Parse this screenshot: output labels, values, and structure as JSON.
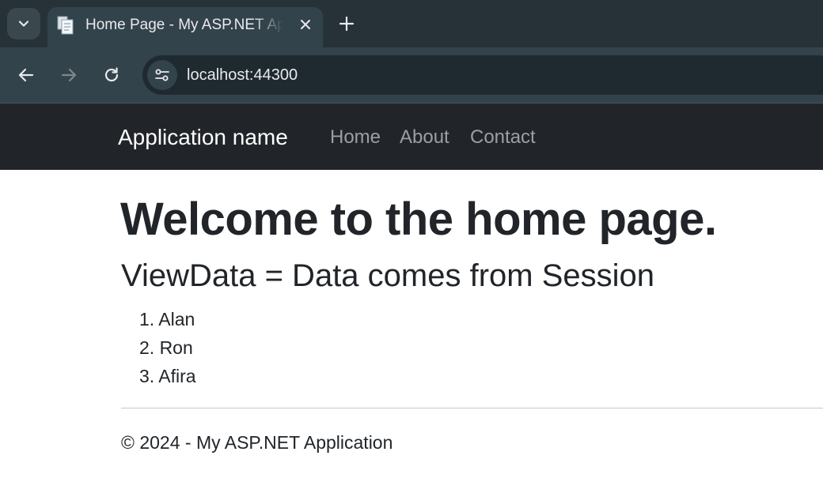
{
  "browser": {
    "tab": {
      "title": "Home Page - My ASP.NET Application"
    },
    "address": {
      "url": "localhost:44300"
    }
  },
  "site": {
    "brand": "Application name",
    "nav": [
      {
        "label": "Home"
      },
      {
        "label": "About"
      },
      {
        "label": "Contact"
      }
    ]
  },
  "main": {
    "heading": "Welcome to the home page.",
    "subheading": "ViewData = Data comes from Session",
    "items": [
      {
        "label": "1. Alan"
      },
      {
        "label": "2. Ron"
      },
      {
        "label": "3. Afira"
      }
    ]
  },
  "footer": {
    "text": "© 2024 - My ASP.NET Application"
  },
  "colors": {
    "tabstrip_bg": "#263238",
    "toolbar_bg": "#33434b",
    "navbar_bg": "#212529",
    "text": "#212529"
  }
}
